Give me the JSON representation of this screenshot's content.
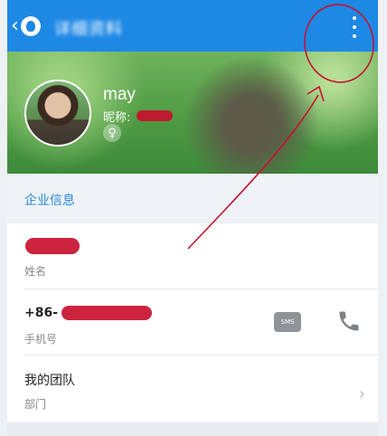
{
  "header": {
    "title": "详细资料",
    "back_icon": "back-chevron-icon",
    "menu_icon": "more-vertical-icon"
  },
  "profile": {
    "name": "may",
    "nickname_label": "昵称:",
    "gender_icon": "female-icon"
  },
  "section": {
    "title": "企业信息"
  },
  "rows": {
    "name": {
      "value": "",
      "label": "姓名"
    },
    "phone": {
      "value": "+86-",
      "label": "手机号",
      "sms_label": "SMS"
    },
    "team": {
      "value": "我的团队",
      "label": "部门"
    }
  },
  "colors": {
    "accent": "#1e88e5",
    "section_text": "#2b87d8",
    "annotation": "#c8102e"
  }
}
